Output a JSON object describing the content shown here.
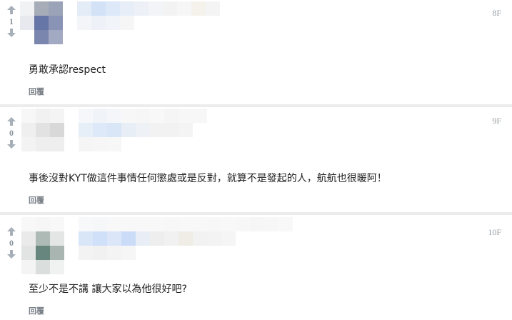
{
  "comments": [
    {
      "vote_count": "1",
      "floor": "8F",
      "content": "勇敢承認respect",
      "reply_label": "回覆"
    },
    {
      "vote_count": "0",
      "floor": "9F",
      "content": "事後沒對KYT做這件事情任何懲處或是反對，就算不是發起的人，航航也很暖阿！",
      "reply_label": "回覆"
    },
    {
      "vote_count": "0",
      "floor": "10F",
      "content": "至少不是不講 讓大家以為他很好吧?",
      "reply_label": "回覆"
    }
  ],
  "icons": {
    "upvote": "arrow-up-icon",
    "downvote": "arrow-down-icon"
  },
  "colors": {
    "text": "#222222",
    "muted": "#9aa4ad",
    "divider": "#ececec"
  }
}
